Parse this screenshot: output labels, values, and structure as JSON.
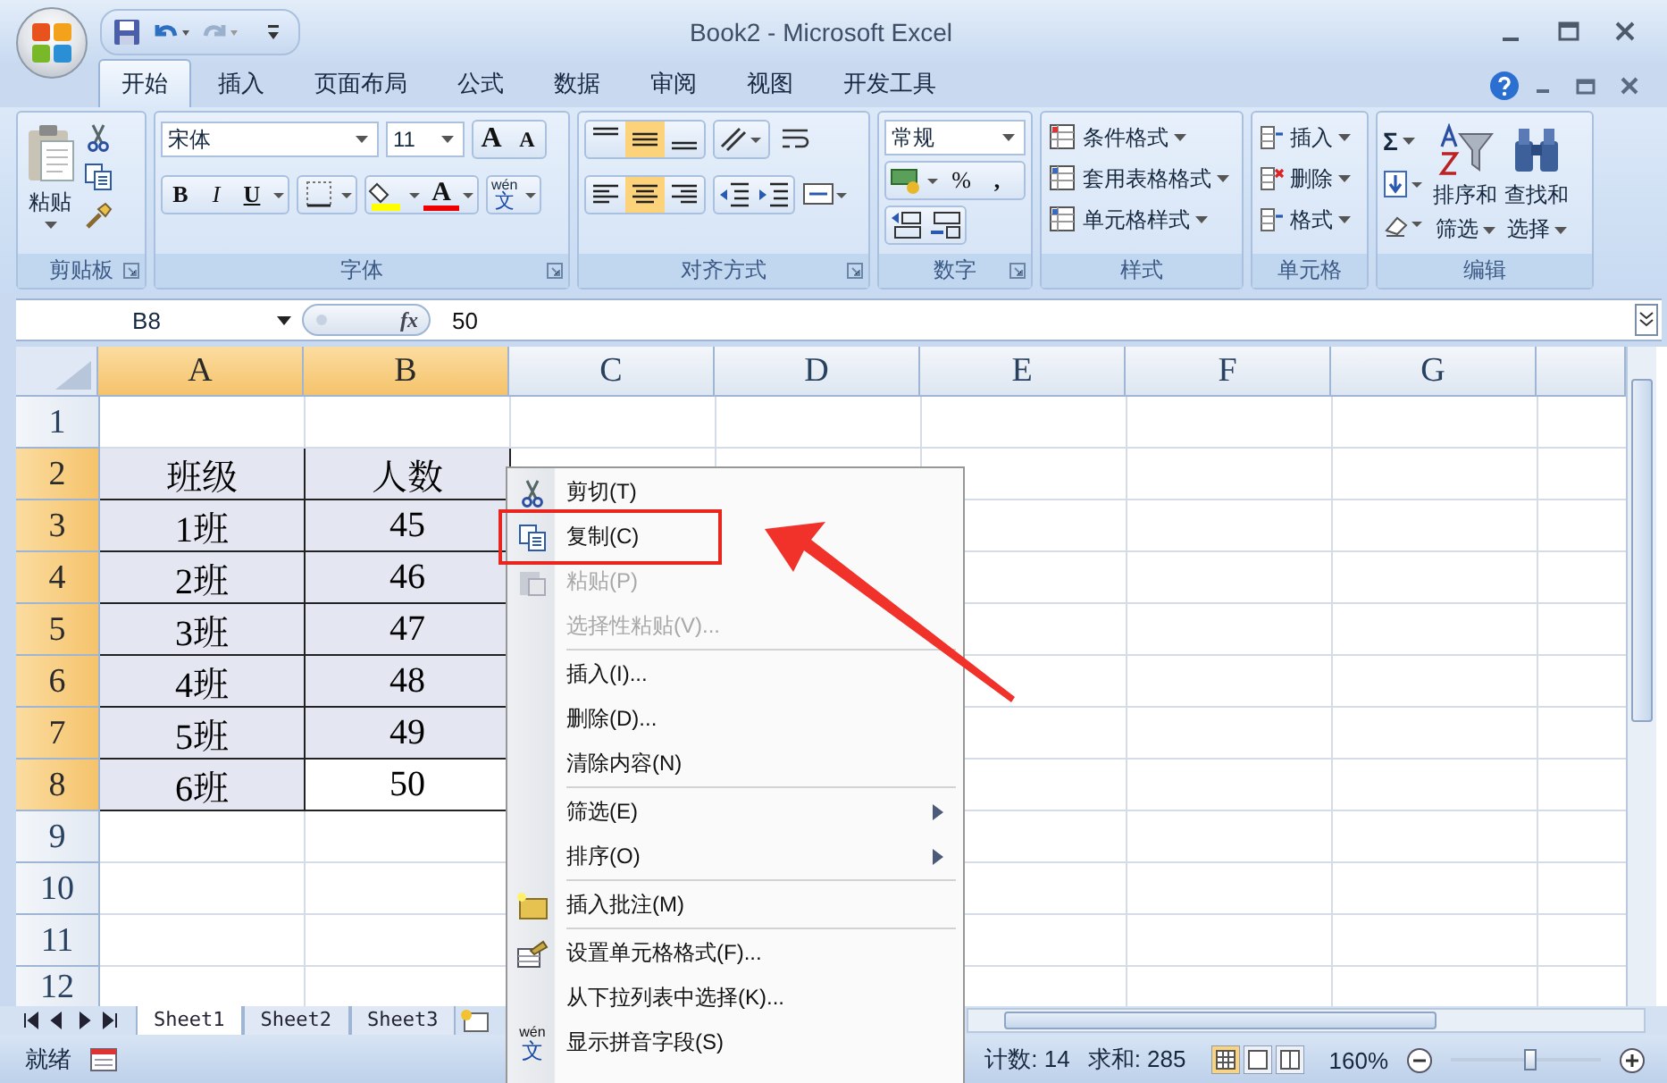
{
  "window": {
    "title": "Book2 - Microsoft Excel"
  },
  "ribbon_tabs": [
    {
      "label": "开始",
      "selected": true
    },
    {
      "label": "插入",
      "selected": false
    },
    {
      "label": "页面布局",
      "selected": false
    },
    {
      "label": "公式",
      "selected": false
    },
    {
      "label": "数据",
      "selected": false
    },
    {
      "label": "审阅",
      "selected": false
    },
    {
      "label": "视图",
      "selected": false
    },
    {
      "label": "开发工具",
      "selected": false
    }
  ],
  "clipboard": {
    "title": "剪贴板",
    "paste": "粘贴"
  },
  "font": {
    "title": "字体",
    "name": "宋体",
    "size": "11",
    "grow": "A",
    "shrink": "A",
    "bold": "B",
    "italic": "I",
    "underline": "U",
    "color_letter": "A",
    "phonetic": [
      "wén",
      "文"
    ]
  },
  "alignment": {
    "title": "对齐方式",
    "vertical": [
      {
        "selected": false
      },
      {
        "selected": true
      },
      {
        "selected": false
      }
    ],
    "horizontal": [
      {
        "selected": false
      },
      {
        "selected": true
      },
      {
        "selected": false
      }
    ]
  },
  "number": {
    "title": "数字",
    "format": "常规",
    "percent": "%",
    "comma": ","
  },
  "styles": {
    "title": "样式",
    "buttons": [
      "条件格式",
      "套用表格格式",
      "单元格样式"
    ]
  },
  "cells": {
    "title": "单元格",
    "buttons": [
      "插入",
      "删除",
      "格式"
    ]
  },
  "editing": {
    "title": "编辑",
    "sum": "Σ",
    "sort": [
      "排序和",
      "筛选"
    ],
    "find": [
      "查找和",
      "选择"
    ]
  },
  "formula_bar": {
    "name_box": "B8",
    "function_label": "fx",
    "value": "50"
  },
  "columns": [
    {
      "label": "A",
      "selected": true
    },
    {
      "label": "B",
      "selected": true
    },
    {
      "label": "C",
      "selected": false
    },
    {
      "label": "D",
      "selected": false
    },
    {
      "label": "E",
      "selected": false
    },
    {
      "label": "F",
      "selected": false
    },
    {
      "label": "G",
      "selected": false
    }
  ],
  "rows": [
    {
      "label": "1",
      "selected": false
    },
    {
      "label": "2",
      "selected": true,
      "cells": [
        {
          "text": "班级",
          "selected": true
        },
        {
          "text": "人数",
          "selected": true
        }
      ]
    },
    {
      "label": "3",
      "selected": true,
      "cells": [
        {
          "text": "1班",
          "selected": true
        },
        {
          "text": "45",
          "selected": true
        }
      ]
    },
    {
      "label": "4",
      "selected": true,
      "cells": [
        {
          "text": "2班",
          "selected": true
        },
        {
          "text": "46",
          "selected": true
        }
      ]
    },
    {
      "label": "5",
      "selected": true,
      "cells": [
        {
          "text": "3班",
          "selected": true
        },
        {
          "text": "47",
          "selected": true
        }
      ]
    },
    {
      "label": "6",
      "selected": true,
      "cells": [
        {
          "text": "4班",
          "selected": true
        },
        {
          "text": "48",
          "selected": true
        }
      ]
    },
    {
      "label": "7",
      "selected": true,
      "cells": [
        {
          "text": "5班",
          "selected": true
        },
        {
          "text": "49",
          "selected": true
        }
      ]
    },
    {
      "label": "8",
      "selected": true,
      "cells": [
        {
          "text": "6班",
          "selected": true
        },
        {
          "text": "50",
          "selected": false
        }
      ]
    },
    {
      "label": "9",
      "selected": false
    },
    {
      "label": "10",
      "selected": false
    },
    {
      "label": "11",
      "selected": false
    },
    {
      "label": "12",
      "selected": false
    }
  ],
  "context_menu": [
    {
      "kind": "command",
      "label": "剪切(T)",
      "disabled": false
    },
    {
      "kind": "command",
      "label": "复制(C)",
      "disabled": false
    },
    {
      "kind": "command",
      "label": "粘贴(P)",
      "disabled": true
    },
    {
      "kind": "command",
      "label": "选择性粘贴(V)...",
      "disabled": true
    },
    {
      "kind": "separator"
    },
    {
      "kind": "command",
      "label": "插入(I)...",
      "disabled": false
    },
    {
      "kind": "command",
      "label": "删除(D)...",
      "disabled": false
    },
    {
      "kind": "command",
      "label": "清除内容(N)",
      "disabled": false
    },
    {
      "kind": "separator"
    },
    {
      "kind": "submenu",
      "label": "筛选(E)",
      "disabled": false
    },
    {
      "kind": "submenu",
      "label": "排序(O)",
      "disabled": false
    },
    {
      "kind": "separator"
    },
    {
      "kind": "command",
      "label": "插入批注(M)",
      "disabled": false
    },
    {
      "kind": "separator"
    },
    {
      "kind": "command",
      "label": "设置单元格格式(F)...",
      "disabled": false
    },
    {
      "kind": "command",
      "label": "从下拉列表中选择(K)...",
      "disabled": false
    },
    {
      "kind": "command",
      "label": "显示拼音字段(S)",
      "disabled": false,
      "glyph": [
        "wén",
        "文"
      ]
    }
  ],
  "sheet_tabs": [
    {
      "label": "Sheet1",
      "selected": true
    },
    {
      "label": "Sheet2",
      "selected": false
    },
    {
      "label": "Sheet3",
      "selected": false
    }
  ],
  "status_bar": {
    "state": "就绪",
    "count": "计数: 14",
    "sum": "求和: 285",
    "views": [
      {
        "selected": true
      },
      {
        "selected": false
      },
      {
        "selected": false
      }
    ],
    "zoom": {
      "reading": "160%",
      "level": 0.52
    }
  }
}
